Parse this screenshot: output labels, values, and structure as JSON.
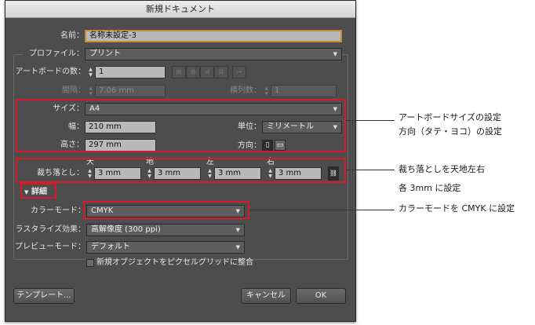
{
  "dialog": {
    "title": "新規ドキュメント",
    "name_label": "名前：",
    "name_value": "名称未設定-3",
    "profile_label": "プロファイル：",
    "profile_value": "プリント",
    "artboards_label": "アートボードの数：",
    "artboards_value": "1",
    "spacing_label": "間隔：",
    "spacing_value": "7.06 mm",
    "columns_label": "横列数：",
    "columns_value": "1",
    "size_label": "サイズ：",
    "size_value": "A4",
    "width_label": "幅：",
    "width_value": "210 mm",
    "units_label": "単位：",
    "units_value": "ミリメートル",
    "height_label": "高さ：",
    "height_value": "297 mm",
    "orientation_label": "方向：",
    "bleed_label": "裁ち落とし：",
    "bleed": [
      {
        "label": "天",
        "value": "3 mm"
      },
      {
        "label": "地",
        "value": "3 mm"
      },
      {
        "label": "左",
        "value": "3 mm"
      },
      {
        "label": "右",
        "value": "3 mm"
      }
    ],
    "advanced_label": "詳細",
    "color_mode_label": "カラーモード：",
    "color_mode_value": "CMYK",
    "raster_label": "ラスタライズ効果：",
    "raster_value": "高解像度 (300 ppi)",
    "preview_label": "プレビューモード：",
    "preview_value": "デフォルト",
    "pixel_grid_label": "新規オブジェクトをピクセルグリッドに整合",
    "template_button": "テンプレート...",
    "cancel_button": "キャンセル",
    "ok_button": "OK"
  },
  "annotations": {
    "size_line1": "アートボードサイズの設定",
    "size_line2": "方向（タテ・ヨコ）の設定",
    "bleed_line1": "裁ち落としを天地左右",
    "bleed_line2": "各 3mm に設定",
    "color_line1": "カラーモードを CMYK に設定"
  },
  "colors": {
    "highlight": "#d9192b",
    "dialog_bg": "#4d4d4d",
    "focus": "#c98a3a"
  }
}
